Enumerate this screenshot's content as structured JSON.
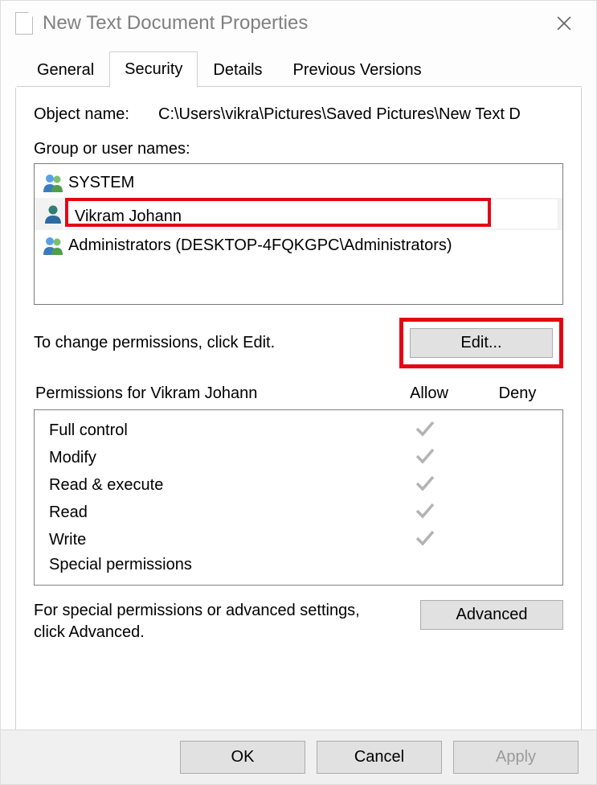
{
  "window": {
    "title": "New Text Document Properties"
  },
  "tabs": {
    "general": "General",
    "security": "Security",
    "details": "Details",
    "previous": "Previous Versions",
    "active": "security"
  },
  "object": {
    "label": "Object name:",
    "path": "C:\\Users\\vikra\\Pictures\\Saved Pictures\\New Text D"
  },
  "groups": {
    "label": "Group or user names:",
    "items": [
      {
        "name": "SYSTEM",
        "variant": "multi"
      },
      {
        "name": "Vikram Johann",
        "variant": "single",
        "selected": true,
        "redacted": true
      },
      {
        "name": "Administrators (DESKTOP-4FQKGPC\\Administrators)",
        "variant": "multi"
      }
    ]
  },
  "editHint": "To change permissions, click Edit.",
  "editButton": "Edit...",
  "permissions": {
    "heading_for": "Permissions for Vikram Johann",
    "allow": "Allow",
    "deny": "Deny",
    "rows": [
      {
        "name": "Full control",
        "allow": true,
        "deny": false
      },
      {
        "name": "Modify",
        "allow": true,
        "deny": false
      },
      {
        "name": "Read & execute",
        "allow": true,
        "deny": false
      },
      {
        "name": "Read",
        "allow": true,
        "deny": false
      },
      {
        "name": "Write",
        "allow": true,
        "deny": false
      },
      {
        "name": "Special permissions",
        "allow": false,
        "deny": false
      }
    ]
  },
  "advanced": {
    "text": "For special permissions or advanced settings, click Advanced.",
    "button": "Advanced"
  },
  "footer": {
    "ok": "OK",
    "cancel": "Cancel",
    "apply": "Apply"
  }
}
